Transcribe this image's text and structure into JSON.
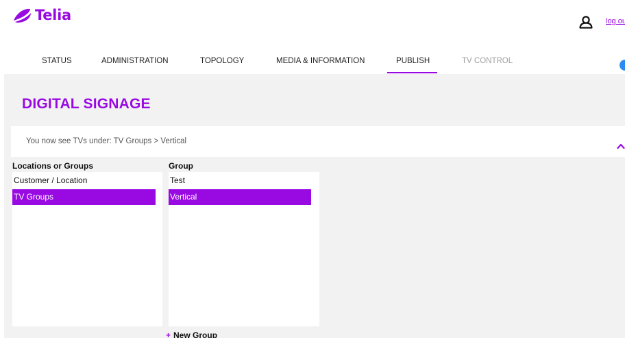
{
  "brand": {
    "name": "Telia",
    "accent": "#990ae3"
  },
  "header": {
    "logout_label": "log out",
    "user_icon": "user-icon"
  },
  "nav": {
    "items": [
      {
        "label": "STATUS",
        "disabled": false,
        "active": false
      },
      {
        "label": "ADMINISTRATION",
        "disabled": false,
        "active": false
      },
      {
        "label": "TOPOLOGY",
        "disabled": false,
        "active": false
      },
      {
        "label": "MEDIA & INFORMATION",
        "disabled": false,
        "active": false
      },
      {
        "label": "PUBLISH",
        "disabled": false,
        "active": true
      },
      {
        "label": "TV CONTROL",
        "disabled": true,
        "active": false
      }
    ]
  },
  "page": {
    "title": "DIGITAL SIGNAGE",
    "info_text": "You now see TVs under: TV Groups > Vertical"
  },
  "locations": {
    "label": "Locations or Groups",
    "items": [
      {
        "label": "Customer / Location",
        "selected": false
      },
      {
        "label": "TV Groups",
        "selected": true
      }
    ]
  },
  "groups": {
    "label": "Group",
    "items": [
      {
        "label": "Test",
        "selected": false
      },
      {
        "label": "Vertical",
        "selected": true
      }
    ],
    "new_group_label": "New Group"
  }
}
